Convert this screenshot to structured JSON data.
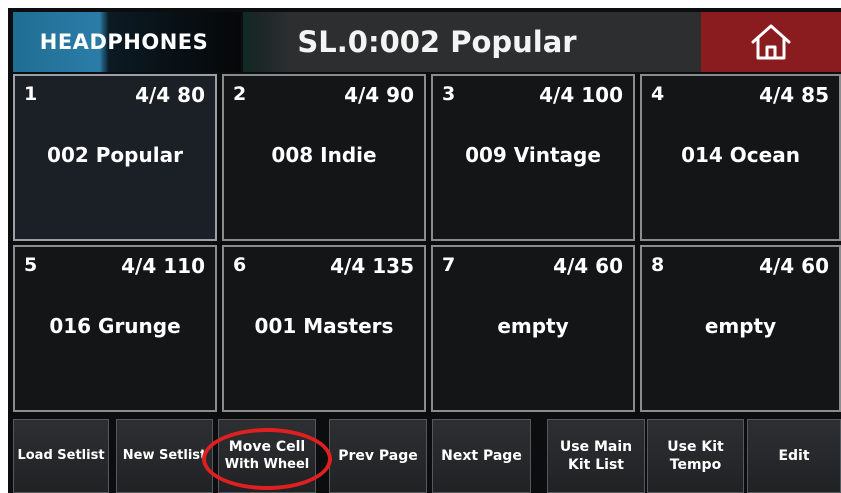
{
  "header": {
    "headphones_label": "HEADPHONES",
    "title": "SL.0:002 Popular",
    "home_icon": "home-icon"
  },
  "cells": [
    {
      "num": "1",
      "tempo": "4/4 80",
      "name": "002 Popular",
      "selected": true
    },
    {
      "num": "2",
      "tempo": "4/4 90",
      "name": "008 Indie"
    },
    {
      "num": "3",
      "tempo": "4/4 100",
      "name": "009 Vintage"
    },
    {
      "num": "4",
      "tempo": "4/4 85",
      "name": "014 Ocean"
    },
    {
      "num": "5",
      "tempo": "4/4 110",
      "name": "016 Grunge"
    },
    {
      "num": "6",
      "tempo": "4/4 135",
      "name": "001 Masters"
    },
    {
      "num": "7",
      "tempo": "4/4 60",
      "name": "empty"
    },
    {
      "num": "8",
      "tempo": "4/4 60",
      "name": "empty"
    }
  ],
  "toolbar": {
    "load_setlist": "Load Setlist",
    "new_setlist": "New Setlist",
    "move_cell_line1": "Move Cell",
    "move_cell_line2": "With Wheel",
    "prev_page": "Prev Page",
    "next_page": "Next Page",
    "use_main_line1": "Use Main",
    "use_main_line2": "Kit List",
    "use_kit_line1": "Use Kit",
    "use_kit_line2": "Tempo",
    "edit": "Edit"
  },
  "colors": {
    "home_red": "#8a1b1e",
    "headphones_blue": "#2b7da8",
    "highlight_red": "#e02020"
  }
}
